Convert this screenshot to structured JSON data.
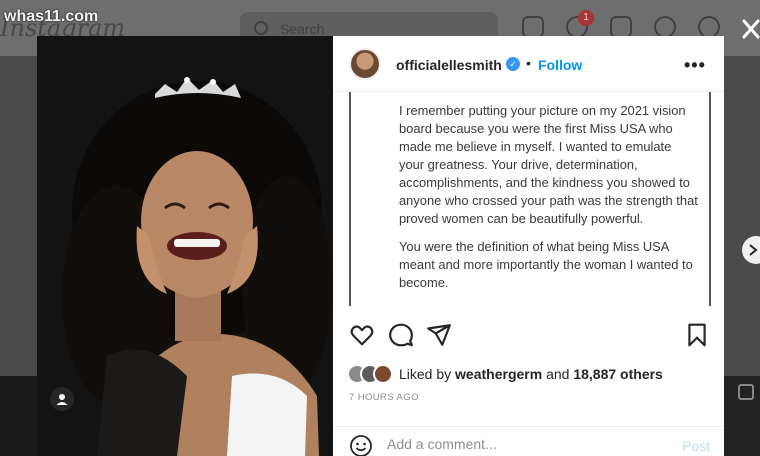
{
  "watermark": "whas11.com",
  "background": {
    "logo": "Instagram",
    "search_placeholder": "Search",
    "notification_count": "1",
    "nav_icons": [
      "home-icon",
      "activity-icon",
      "new-post-icon",
      "explore-icon",
      "heart-icon"
    ]
  },
  "post": {
    "author": "officialellesmith",
    "verified": true,
    "separator": "•",
    "follow_label": "Follow",
    "more_label": "•••",
    "caption_paragraphs": [
      "I remember putting your picture on my 2021 vision board because you were the first Miss USA who made me believe in myself. I wanted to emulate your greatness. Your drive, determination, accomplishments, and the kindness you showed to anyone who crossed your path was the strength that proved women can be beautifully powerful.",
      "You were the definition of what being Miss USA meant and more importantly the woman I wanted to become."
    ],
    "likes": {
      "prefix": "Liked by",
      "user": "weathergerm",
      "middle": "and",
      "count": "18,887 others"
    },
    "timestamp": "7 HOURS AGO",
    "comment_placeholder": "Add a comment...",
    "post_label": "Post"
  },
  "colors": {
    "accent": "#0095f6",
    "verified": "#3897f0",
    "post_disabled": "#b2dffc"
  }
}
